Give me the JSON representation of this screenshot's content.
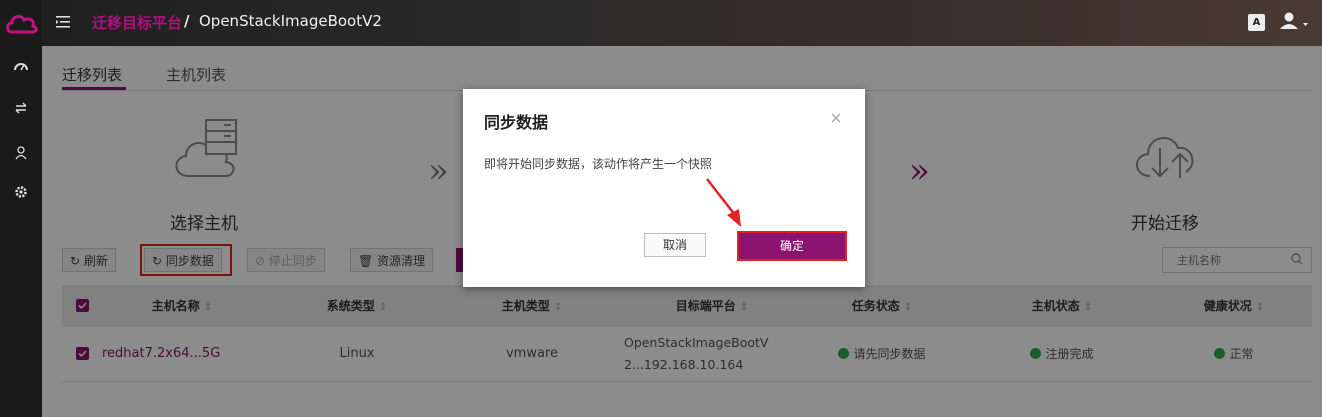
{
  "header": {
    "breadcrumb_link": "迁移目标平台",
    "breadcrumb_sep": "/",
    "breadcrumb_current": "OpenStackImageBootV2",
    "lang_label": "A"
  },
  "tabs": [
    {
      "label": "迁移列表",
      "active": true
    },
    {
      "label": "主机列表",
      "active": false
    }
  ],
  "steps": {
    "select_host": "选择主机",
    "start_migration": "开始迁移"
  },
  "toolbar": {
    "refresh": "刷新",
    "sync_data": "同步数据",
    "stop_sync": "停止同步",
    "cleanup": "资源清理"
  },
  "search": {
    "placeholder": "主机名称"
  },
  "table": {
    "columns": [
      "主机名称",
      "系统类型",
      "主机类型",
      "目标端平台",
      "任务状态",
      "主机状态",
      "健康状况"
    ],
    "rows": [
      {
        "host_name": "redhat7.2x64...5G",
        "os_type": "Linux",
        "host_type": "vmware",
        "target_platform_line1": "OpenStackImageBootV",
        "target_platform_line2": "2...192.168.10.164",
        "task_status": "请先同步数据",
        "host_status": "注册完成",
        "health": "正常"
      }
    ]
  },
  "dialog": {
    "title": "同步数据",
    "message": "即将开始同步数据，该动作将产生一个快照",
    "cancel_label": "取消",
    "ok_label": "确定"
  },
  "colors": {
    "accent": "#8c1470",
    "highlight": "#e02424",
    "status_ok": "#2eae4b"
  }
}
